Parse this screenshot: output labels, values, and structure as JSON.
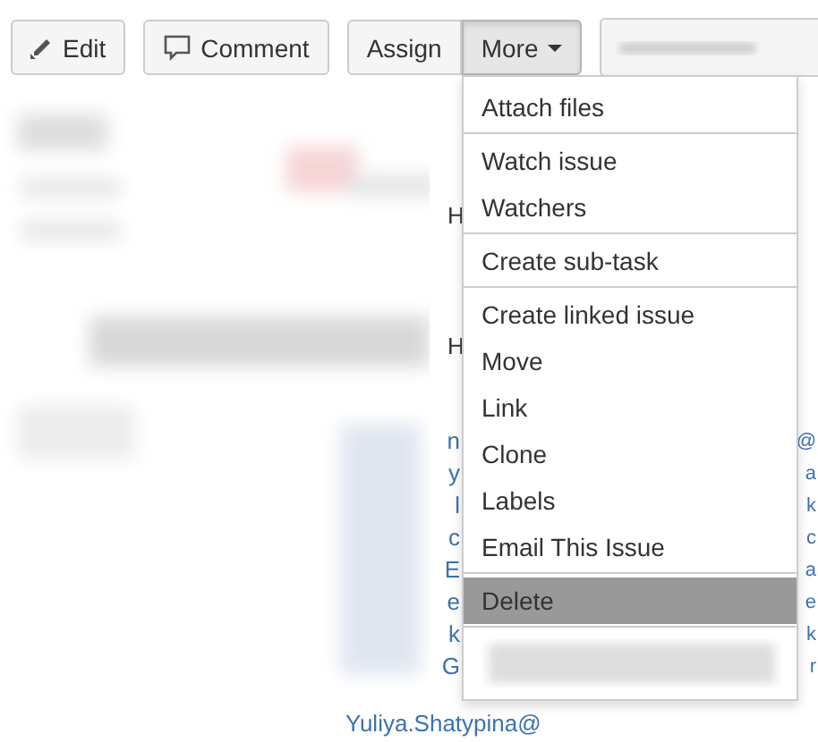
{
  "toolbar": {
    "buttons": [
      {
        "label": "Edit",
        "kind": "edit",
        "pressed": false
      },
      {
        "label": "Comment",
        "kind": "comment",
        "pressed": false
      },
      {
        "label": "Assign",
        "kind": "plain",
        "pressed": false
      },
      {
        "label": "More",
        "kind": "dropdown",
        "pressed": true
      }
    ]
  },
  "background": {
    "headings": [
      "H",
      "H"
    ],
    "rows": [
      {
        "left": "n",
        "right": "@"
      },
      {
        "left": "y",
        "right": "a"
      },
      {
        "left": "l",
        "right": "k"
      },
      {
        "left": "c",
        "right": "c"
      },
      {
        "left": "E",
        "right": "a"
      },
      {
        "left": "e",
        "right": "e"
      },
      {
        "left": "k",
        "right": "k"
      },
      {
        "left": "G",
        "right": "r"
      }
    ],
    "footer_line": "Yuliya.Shatypina@"
  },
  "menu": {
    "groups": [
      [
        {
          "label": "Attach files",
          "selected": false
        }
      ],
      [
        {
          "label": "Watch issue",
          "selected": false
        },
        {
          "label": "Watchers",
          "selected": false
        }
      ],
      [
        {
          "label": "Create sub-task",
          "selected": false
        }
      ],
      [
        {
          "label": "Create linked issue",
          "selected": false
        },
        {
          "label": "Move",
          "selected": false
        },
        {
          "label": "Link",
          "selected": false
        },
        {
          "label": "Clone",
          "selected": false
        },
        {
          "label": "Labels",
          "selected": false
        },
        {
          "label": "Email This Issue",
          "selected": false
        }
      ],
      [
        {
          "label": "Delete",
          "selected": true
        }
      ]
    ]
  }
}
